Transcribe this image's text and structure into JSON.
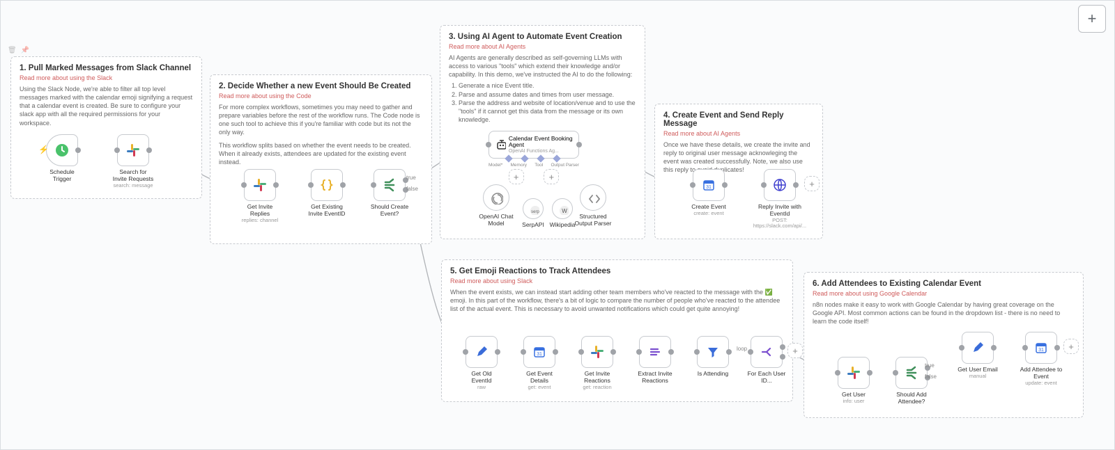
{
  "sections": {
    "s1": {
      "title": "1. Pull Marked Messages from Slack Channel",
      "read_more": "Read more about using the Slack",
      "desc": "Using the Slack Node, we're able to filter all top level messages marked with the calendar emoji signifying a request that a calendar event is created. Be sure to configure your slack app with all the required permissions for your workspace."
    },
    "s2": {
      "title": "2. Decide Whether a new Event Should Be Created",
      "read_more": "Read more about using the Code",
      "desc1": "For more complex workflows, sometimes you may need to gather and prepare variables before the rest of the workflow runs. The Code node is one such tool to achieve this if you're familiar with code but its not the only way.",
      "desc2": "This workflow splits based on whether the event needs to be created. When it already exists, attendees are updated for the existing event instead."
    },
    "s3": {
      "title": "3. Using AI Agent to Automate Event Creation",
      "read_more": "Read more about AI Agents",
      "desc": "AI Agents are generally described as self-governing LLMs with access to various \"tools\" which extend their knowledge and/or capability. In this demo, we've instructed the AI to do the following:",
      "li1": "Generate a nice Event title.",
      "li2": "Parse and assume dates and times from user message.",
      "li3": "Parse the address and website of location/venue and to use the \"tools\" if it cannot get this data from the message or its own knowledge."
    },
    "s4": {
      "title": "4. Create Event and Send Reply Message",
      "read_more": "Read more about AI Agents",
      "desc": "Once we have these details, we create the invite and reply to original user message acknowleging the event was created successfully. Note, we also use this reply to avoid duplicates!"
    },
    "s5": {
      "title": "5. Get Emoji Reactions to Track Attendees",
      "read_more": "Read more about using Slack",
      "desc": "When the event exists, we can instead start adding other team members who've reacted to the message with the ✅ emoji. In this part of the workflow, there's a bit of logic to compare the number of people who've reacted to the attendee list of the actual event. This is necessary to avoid unwanted notifications which could get quite annoying!"
    },
    "s6": {
      "title": "6. Add Attendees to Existing Calendar Event",
      "read_more": "Read more about using Google Calendar",
      "desc": "n8n nodes make it easy to work with Google Calendar by having great coverage on the Google API. Most common actions can be found in the dropdown list - there is no need to learn the code itself!"
    }
  },
  "nodes": {
    "schedule": {
      "label": "Schedule Trigger",
      "sub": ""
    },
    "search": {
      "label": "Search for Invite Requests",
      "sub": "search: message"
    },
    "replies": {
      "label": "Get Invite Replies",
      "sub": "replies: channel"
    },
    "existing": {
      "label": "Get Existing Invite EventID",
      "sub": ""
    },
    "should": {
      "label": "Should Create Event?",
      "sub": ""
    },
    "agent": {
      "label": "Calendar Event Booking Agent",
      "sub": "OpenAI Functions Ag..."
    },
    "model": {
      "label": "OpenAI Chat Model",
      "sub": ""
    },
    "serp": {
      "label": "SerpAPI",
      "sub": ""
    },
    "wiki": {
      "label": "Wikipedia",
      "sub": ""
    },
    "parser": {
      "label": "Structured Output Parser",
      "sub": ""
    },
    "subports": {
      "model": "Model*",
      "memory": "Memory",
      "tool": "Tool",
      "output": "Output Parser"
    },
    "create": {
      "label": "Create Event",
      "sub": "create: event"
    },
    "reply": {
      "label": "Reply Invite with EventId",
      "sub": "POST: https://slack.com/api/..."
    },
    "oldid": {
      "label": "Get Old EventId",
      "sub": "raw"
    },
    "details": {
      "label": "Get Event Details",
      "sub": "get: event"
    },
    "reactions": {
      "label": "Get Invite Reactions",
      "sub": "get: reaction"
    },
    "extract": {
      "label": "Extract Invite Reactions",
      "sub": ""
    },
    "attending": {
      "label": "Is Attending",
      "sub": ""
    },
    "foreach": {
      "label": "For Each User ID...",
      "sub": ""
    },
    "getuser": {
      "label": "Get User",
      "sub": "info: user"
    },
    "shouldadd": {
      "label": "Should Add Attendee?",
      "sub": ""
    },
    "email": {
      "label": "Get User Email",
      "sub": "manual"
    },
    "addatt": {
      "label": "Add Attendee to Event",
      "sub": "update: event"
    }
  },
  "switch": {
    "t": "true",
    "f": "false",
    "loop": "loop"
  },
  "icons": {
    "schedule": "clock",
    "slack": "slack",
    "code": "braces",
    "switch": "switch",
    "robot": "robot",
    "openai": "openai",
    "serp": "serp",
    "wiki": "wiki",
    "parser": "codebrackets",
    "gcal": "gcal",
    "globe": "globe",
    "pencil": "pencil",
    "filter": "filter",
    "split": "split",
    "lines": "lines"
  }
}
